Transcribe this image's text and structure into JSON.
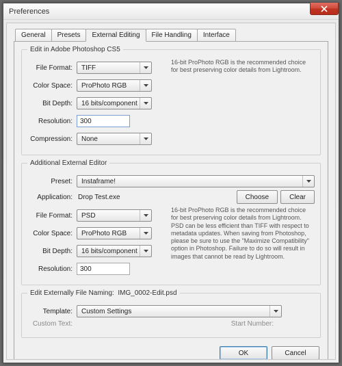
{
  "window": {
    "title": "Preferences"
  },
  "tabs": {
    "general": "General",
    "presets": "Presets",
    "external_editing": "External Editing",
    "file_handling": "File Handling",
    "interface": "Interface"
  },
  "group1": {
    "legend": "Edit in Adobe Photoshop CS5",
    "labels": {
      "file_format": "File Format:",
      "color_space": "Color Space:",
      "bit_depth": "Bit Depth:",
      "resolution": "Resolution:",
      "compression": "Compression:"
    },
    "values": {
      "file_format": "TIFF",
      "color_space": "ProPhoto RGB",
      "bit_depth": "16 bits/component",
      "resolution": "300",
      "compression": "None"
    },
    "info": "16-bit ProPhoto RGB is the recommended choice for best preserving color details from Lightroom."
  },
  "group2": {
    "legend": "Additional External Editor",
    "labels": {
      "preset": "Preset:",
      "application": "Application:",
      "file_format": "File Format:",
      "color_space": "Color Space:",
      "bit_depth": "Bit Depth:",
      "resolution": "Resolution:"
    },
    "values": {
      "preset": "Instaframe!",
      "application": "Drop Test.exe",
      "file_format": "PSD",
      "color_space": "ProPhoto RGB",
      "bit_depth": "16 bits/component",
      "resolution": "300"
    },
    "buttons": {
      "choose": "Choose",
      "clear": "Clear"
    },
    "info": "16-bit ProPhoto RGB is the recommended choice for best preserving color details from Lightroom. PSD can be less efficient than TIFF with respect to metadata updates. When saving from Photoshop, please be sure to use the \"Maximize Compatibility\" option in Photoshop. Failure to do so will result in images that cannot be read by Lightroom."
  },
  "group3": {
    "legend_prefix": "Edit Externally File Naming:",
    "legend_value": "IMG_0002-Edit.psd",
    "labels": {
      "template": "Template:",
      "custom_text": "Custom Text:",
      "start_number": "Start Number:"
    },
    "values": {
      "template": "Custom Settings"
    }
  },
  "footer": {
    "ok": "OK",
    "cancel": "Cancel"
  }
}
